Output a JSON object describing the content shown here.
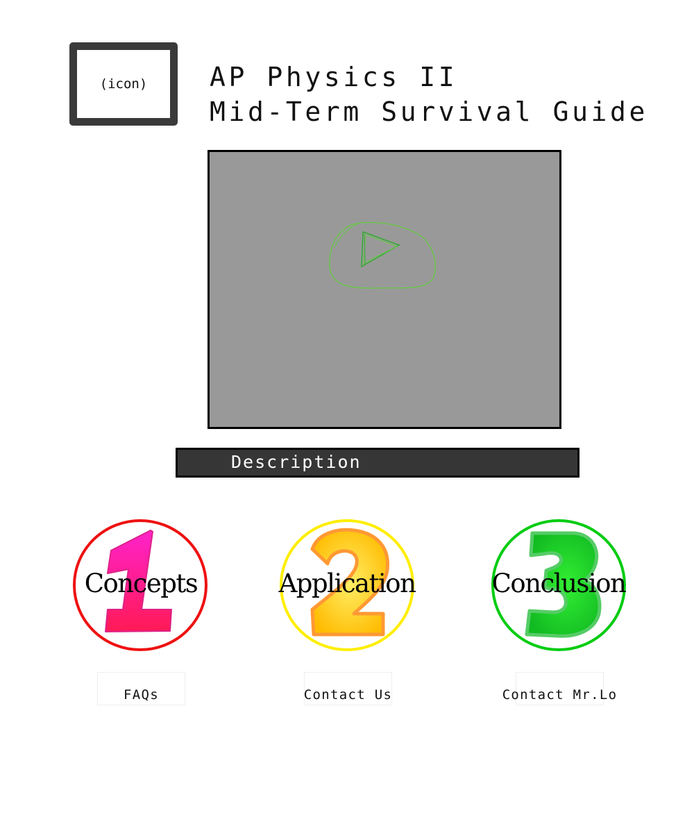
{
  "header": {
    "icon_placeholder": "(icon)",
    "title_line1": "AP Physics II",
    "title_line2": "Mid-Term Survival Guide"
  },
  "video": {
    "icon": "play-button-icon",
    "background_color": "#999999",
    "icon_color": "#66cc44"
  },
  "description": {
    "label": "Description"
  },
  "sections": [
    {
      "number": "1",
      "label": "Concepts",
      "ring_color": "#ee1111",
      "digit_color": "#ff1a80"
    },
    {
      "number": "2",
      "label": "Application",
      "ring_color": "#ffee00",
      "digit_color": "#ffcc00"
    },
    {
      "number": "3",
      "label": "Conclusion",
      "ring_color": "#00cc11",
      "digit_color": "#22dd22"
    }
  ],
  "footer": {
    "links": [
      {
        "label": "FAQs"
      },
      {
        "label": "Contact Us"
      },
      {
        "label": "Contact Mr.Lo"
      }
    ]
  }
}
